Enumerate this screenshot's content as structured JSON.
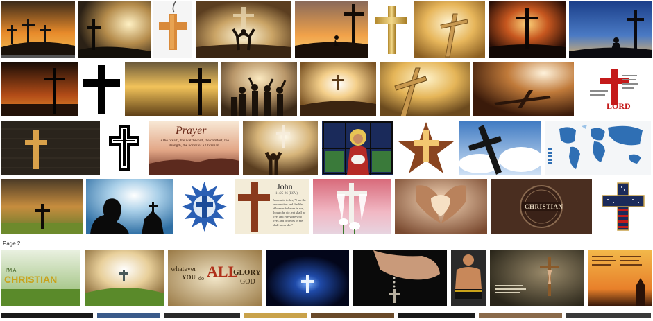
{
  "results": {
    "page_label": "Page 2",
    "overlays": {
      "prayer_title": "Prayer",
      "prayer_body": "is the breath, the watchword, the comfort, the strength, the honor of a Christian.",
      "john_title": "John",
      "john_ref": "11:25-26 (ESV)",
      "john_body": "Jesus said to her, \"I am the resurrection and the life. Whoever believes in me, though he die, yet shall he live, and everyone who lives and believes in me shall never die.\"",
      "lord_text": "LORD",
      "christian_badge": "CHRISTIAN",
      "christian_banner": "CHRISTIAN",
      "im_a": "I'M A",
      "whatever": "whatever",
      "you": "YOU",
      "do": "do",
      "all": "ALL",
      "glory": "GLORY",
      "god": "GOD"
    }
  },
  "colors": {
    "background": "#ffffff",
    "page_label": "#222222"
  }
}
